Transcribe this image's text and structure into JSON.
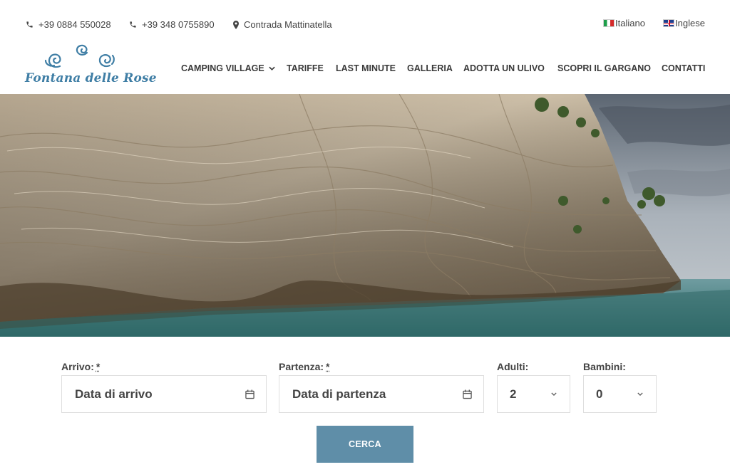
{
  "topbar": {
    "phone1": "+39 0884 550028",
    "phone2": "+39 348 0755890",
    "address": "Contrada Mattinatella",
    "lang_it": "Italiano",
    "lang_en": "Inglese"
  },
  "logo": {
    "text": "Fontana delle Rose"
  },
  "nav": {
    "items": [
      {
        "label": "CAMPING VILLAGE"
      },
      {
        "label": "TARIFFE"
      },
      {
        "label": "LAST MINUTE"
      },
      {
        "label": "GALLERIA"
      },
      {
        "label": "ADOTTA UN ULIVO"
      },
      {
        "label": "SCOPRI IL GARGANO"
      },
      {
        "label": "CONTATTI"
      }
    ]
  },
  "form": {
    "arrival_label": "Arrivo:",
    "departure_label": "Partenza:",
    "required_mark": "*",
    "adults_label": "Adulti:",
    "children_label": "Bambini:",
    "arrival_placeholder": "Data di arrivo",
    "departure_placeholder": "Data di partenza",
    "adults_value": "2",
    "children_value": "0",
    "submit_label": "CERCA"
  },
  "colors": {
    "accent": "#5f8ea8",
    "logo": "#3f7ea5"
  },
  "icons": {
    "phone": "phone-icon",
    "location": "map-pin-icon",
    "calendar": "calendar-icon",
    "dropdown": "chevron-down-icon"
  }
}
